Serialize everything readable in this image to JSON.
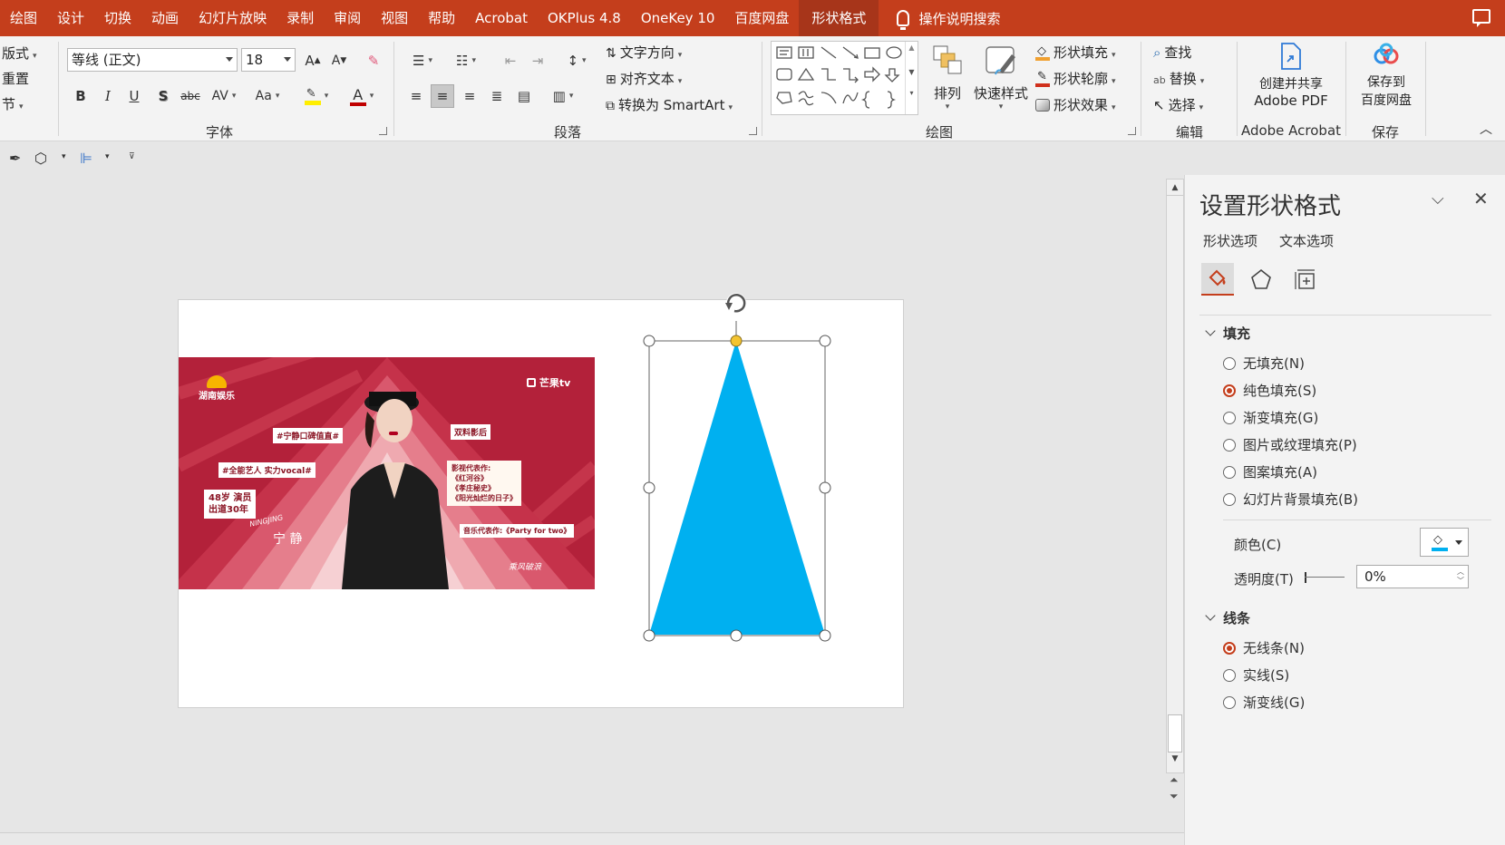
{
  "menubar": {
    "tabs": [
      "绘图",
      "设计",
      "切换",
      "动画",
      "幻灯片放映",
      "录制",
      "审阅",
      "视图",
      "帮助",
      "Acrobat",
      "OKPlus 4.8",
      "OneKey 10",
      "百度网盘",
      "形状格式"
    ],
    "active_tab": "形状格式",
    "tell_me": "操作说明搜索"
  },
  "ribbon": {
    "slides": {
      "layout": "版式",
      "reset": "重置",
      "section": "节"
    },
    "font": {
      "label": "字体",
      "name": "等线 (正文)",
      "size": "18",
      "grow": "A",
      "shrink": "A",
      "bold": "B",
      "italic": "I",
      "underline": "U",
      "shadow": "S",
      "strike": "abc",
      "spacing": "AV",
      "case": "Aa",
      "color_glyph": "A"
    },
    "paragraph": {
      "label": "段落",
      "text_direction": "文字方向",
      "align_text": "对齐文本",
      "smartart": "转换为 SmartArt"
    },
    "drawing": {
      "label": "绘图",
      "arrange": "排列",
      "quick_styles": "快速样式",
      "shape_fill": "形状填充",
      "shape_outline": "形状轮廓",
      "shape_effects": "形状效果"
    },
    "editing": {
      "label": "编辑",
      "find": "查找",
      "replace": "替换",
      "select": "选择"
    },
    "acrobat": {
      "label": "Adobe Acrobat",
      "line1": "创建并共享",
      "line2": "Adobe PDF"
    },
    "save": {
      "label": "保存",
      "line1": "保存到",
      "line2": "百度网盘"
    }
  },
  "photo": {
    "brand_left": "湖南娱乐",
    "brand_right": "芒果tv",
    "tag1": "#宁静口碑值直#",
    "tag2": "#全能艺人 实力vocal#",
    "age": "48岁  演员",
    "debut": "出道30年",
    "name_en": "NINGJING",
    "name": "宁 静",
    "tag_dual": "双料影后",
    "works_title": "影视代表作:",
    "work1": "《红河谷》",
    "work2": "《孝庄秘史》",
    "work3": "《阳光灿烂的日子》",
    "music": "音乐代表作:《Party for two》",
    "show_logo": "乘风破浪"
  },
  "triangle_color": "#00b0f0",
  "accent": "#c43e1c",
  "pane": {
    "title": "设置形状格式",
    "tab_shape": "形状选项",
    "tab_text": "文本选项",
    "fill_section": "填充",
    "fill_options": [
      "无填充(N)",
      "纯色填充(S)",
      "渐变填充(G)",
      "图片或纹理填充(P)",
      "图案填充(A)",
      "幻灯片背景填充(B)"
    ],
    "fill_selected": 1,
    "color_label": "颜色(C)",
    "transparency_label": "透明度(T)",
    "transparency_value": "0%",
    "line_section": "线条",
    "line_options": [
      "无线条(N)",
      "实线(S)",
      "渐变线(G)"
    ],
    "line_selected": 0
  }
}
